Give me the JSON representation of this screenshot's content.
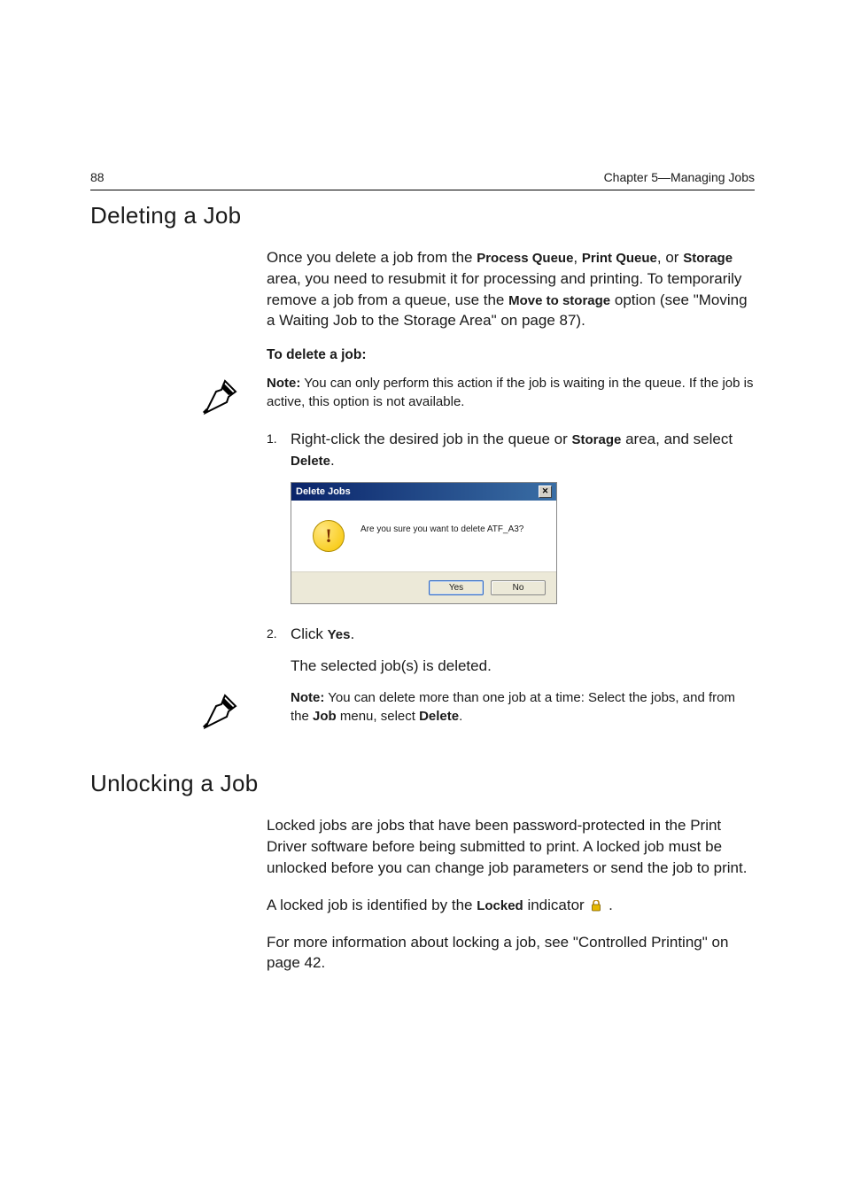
{
  "header": {
    "page_number": "88",
    "chapter": "Chapter 5—Managing Jobs"
  },
  "delete_section": {
    "heading": "Deleting a Job",
    "intro_p1_a": "Once you delete a job from the ",
    "intro_pq": "Process Queue",
    "intro_comma1": ", ",
    "intro_prq": "Print Queue",
    "intro_or": ", or ",
    "intro_storage": "Storage",
    "intro_p1_b": " area, you need to resubmit it for processing and printing. To temporarily remove a job from a queue, use the ",
    "intro_move": "Move to storage",
    "intro_p1_c": " option (see \"Moving a Waiting Job to the Storage Area\" on page 87).",
    "sub_heading": "To delete a job:",
    "note1_label": "Note:",
    "note1_text": "  You can only perform this action if the job is waiting in the queue. If the job is active, this option is not available.",
    "step1_num": "1.",
    "step1_a": "Right-click the desired job in the queue or ",
    "step1_storage": "Storage",
    "step1_b": " area, and select ",
    "step1_delete": "Delete",
    "step1_c": ".",
    "dialog": {
      "title": "Delete Jobs",
      "message": "Are you sure you want to delete ATF_A3?",
      "yes": "Yes",
      "no": "No"
    },
    "step2_num": "2.",
    "step2_a": "Click ",
    "step2_yes": "Yes",
    "step2_b": ".",
    "step2_result": "The selected job(s) is deleted.",
    "note2_label": "Note:",
    "note2_a": "  You can delete more than one job at a time: Select the jobs, and from the ",
    "note2_job": "Job",
    "note2_b": " menu, select ",
    "note2_delete": "Delete",
    "note2_c": "."
  },
  "unlock_section": {
    "heading": "Unlocking a Job",
    "para1": "Locked jobs are jobs that have been password-protected in the Print Driver software before being submitted to print. A locked job must be unlocked before you can change job parameters or send the job to print.",
    "para2_a": "A locked job is identified by the ",
    "para2_locked": "Locked",
    "para2_b": " indicator ",
    "para2_c": " .",
    "para3": "For more information about locking a job, see \"Controlled Printing\" on page 42."
  }
}
